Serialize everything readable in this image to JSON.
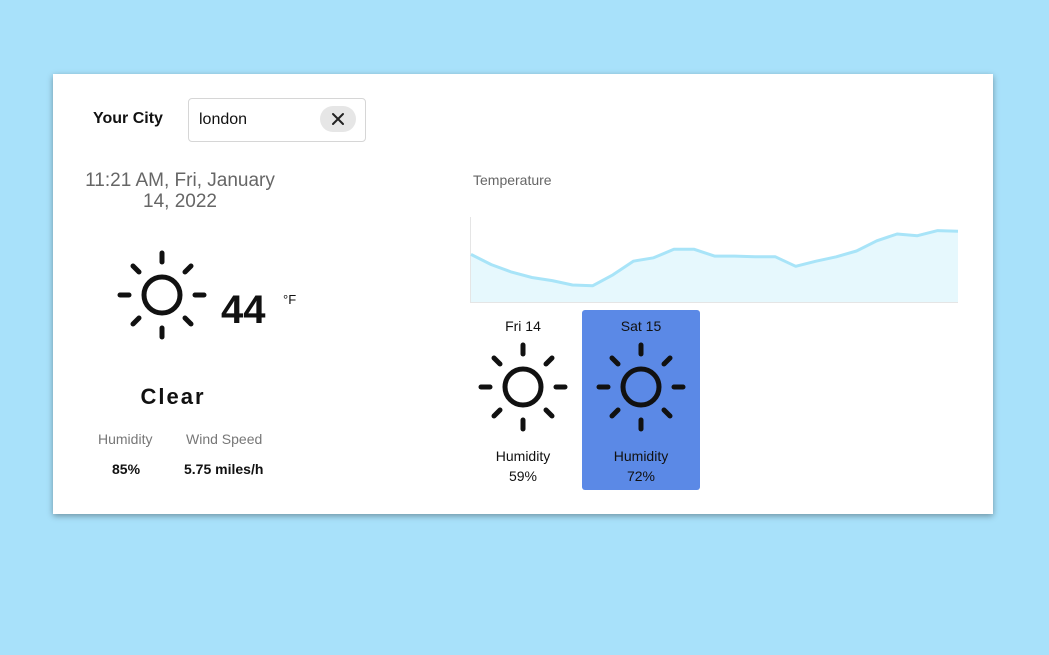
{
  "search": {
    "label": "Your City",
    "value": "london"
  },
  "current": {
    "datetime": "11:21 AM, Fri, January 14, 2022",
    "temperature": "44",
    "unit": "°F",
    "condition": "Clear",
    "icon": "sun-icon",
    "humidity_label": "Humidity",
    "humidity_value": "85%",
    "wind_label": "Wind Speed",
    "wind_value": "5.75 miles/h"
  },
  "chart": {
    "title": "Temperature",
    "line_color": "#a8e4f8",
    "fill_color": "#e6f8fd"
  },
  "chart_data": {
    "type": "area",
    "title": "Temperature",
    "values": [
      44,
      41,
      38.8,
      37.2,
      36.3,
      35,
      34.8,
      38,
      42,
      43,
      45.5,
      45.5,
      43.5,
      43.5,
      43.3,
      43.3,
      40.5,
      42,
      43.3,
      45,
      48,
      50,
      49.5,
      51,
      50.8
    ],
    "xlabel": "",
    "ylabel": "",
    "ylim": [
      30,
      55
    ],
    "grid": false
  },
  "forecast": [
    {
      "day": "Fri 14",
      "icon": "sun-icon",
      "humidity_label": "Humidity",
      "humidity_value": "59%",
      "selected": false
    },
    {
      "day": "Sat 15",
      "icon": "sun-icon",
      "humidity_label": "Humidity",
      "humidity_value": "72%",
      "selected": true
    }
  ],
  "colors": {
    "background": "#a8e1fa",
    "selected_card": "#5b89e6"
  }
}
